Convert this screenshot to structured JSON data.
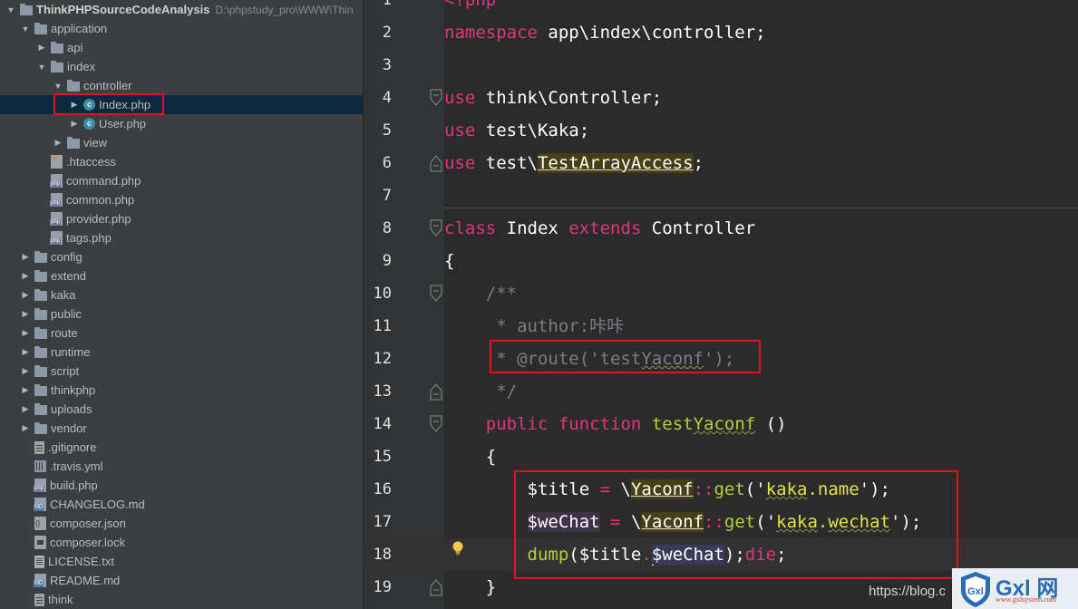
{
  "project_tree": {
    "root_name": "ThinkPHPSourceCodeAnalysis",
    "root_path": "D:\\phpstudy_pro\\WWW\\Thin",
    "items": [
      {
        "label": "application",
        "type": "folder",
        "depth": 1,
        "arrow": "down"
      },
      {
        "label": "api",
        "type": "folder",
        "depth": 2,
        "arrow": "right"
      },
      {
        "label": "index",
        "type": "folder",
        "depth": 2,
        "arrow": "down"
      },
      {
        "label": "controller",
        "type": "folder",
        "depth": 3,
        "arrow": "down"
      },
      {
        "label": "Index.php",
        "type": "class",
        "depth": 4,
        "arrow": "right",
        "selected": true
      },
      {
        "label": "User.php",
        "type": "class",
        "depth": 4,
        "arrow": "right"
      },
      {
        "label": "view",
        "type": "folder",
        "depth": 3,
        "arrow": "right"
      },
      {
        "label": ".htaccess",
        "type": "htaccess",
        "depth": 2,
        "arrow": ""
      },
      {
        "label": "command.php",
        "type": "php",
        "depth": 2,
        "arrow": ""
      },
      {
        "label": "common.php",
        "type": "php",
        "depth": 2,
        "arrow": ""
      },
      {
        "label": "provider.php",
        "type": "php",
        "depth": 2,
        "arrow": ""
      },
      {
        "label": "tags.php",
        "type": "php",
        "depth": 2,
        "arrow": ""
      },
      {
        "label": "config",
        "type": "folder",
        "depth": 1,
        "arrow": "right"
      },
      {
        "label": "extend",
        "type": "folder",
        "depth": 1,
        "arrow": "right"
      },
      {
        "label": "kaka",
        "type": "folder",
        "depth": 1,
        "arrow": "right"
      },
      {
        "label": "public",
        "type": "folder",
        "depth": 1,
        "arrow": "right"
      },
      {
        "label": "route",
        "type": "folder",
        "depth": 1,
        "arrow": "right"
      },
      {
        "label": "runtime",
        "type": "folder",
        "depth": 1,
        "arrow": "right"
      },
      {
        "label": "script",
        "type": "folder",
        "depth": 1,
        "arrow": "right"
      },
      {
        "label": "thinkphp",
        "type": "folder",
        "depth": 1,
        "arrow": "right"
      },
      {
        "label": "uploads",
        "type": "folder",
        "depth": 1,
        "arrow": "right"
      },
      {
        "label": "vendor",
        "type": "folder",
        "depth": 1,
        "arrow": "right"
      },
      {
        "label": ".gitignore",
        "type": "file",
        "depth": 1,
        "arrow": ""
      },
      {
        "label": ".travis.yml",
        "type": "yml",
        "depth": 1,
        "arrow": ""
      },
      {
        "label": "build.php",
        "type": "php",
        "depth": 1,
        "arrow": ""
      },
      {
        "label": "CHANGELOG.md",
        "type": "md",
        "depth": 1,
        "arrow": ""
      },
      {
        "label": "composer.json",
        "type": "json",
        "depth": 1,
        "arrow": ""
      },
      {
        "label": "composer.lock",
        "type": "lock",
        "depth": 1,
        "arrow": ""
      },
      {
        "label": "LICENSE.txt",
        "type": "text",
        "depth": 1,
        "arrow": ""
      },
      {
        "label": "README.md",
        "type": "md",
        "depth": 1,
        "arrow": ""
      },
      {
        "label": "think",
        "type": "file",
        "depth": 1,
        "arrow": ""
      }
    ]
  },
  "editor": {
    "current_line": "18",
    "lines": [
      {
        "num": "1",
        "tokens": [
          {
            "t": "<?php",
            "c": "kw"
          }
        ]
      },
      {
        "num": "2",
        "tokens": [
          {
            "t": "namespace",
            "c": "kw"
          },
          {
            "t": " app\\index\\controller;",
            "c": ""
          }
        ]
      },
      {
        "num": "3",
        "tokens": []
      },
      {
        "num": "4",
        "tokens": [
          {
            "t": "use",
            "c": "kw"
          },
          {
            "t": " think\\Controller;",
            "c": ""
          }
        ]
      },
      {
        "num": "5",
        "tokens": [
          {
            "t": "use",
            "c": "kw"
          },
          {
            "t": " test\\Kaka;",
            "c": ""
          }
        ]
      },
      {
        "num": "6",
        "tokens": [
          {
            "t": "use",
            "c": "kw"
          },
          {
            "t": " test\\",
            "c": ""
          },
          {
            "t": "TestArrayAccess",
            "c": "hl ul"
          },
          {
            "t": ";",
            "c": ""
          }
        ]
      },
      {
        "num": "7",
        "tokens": []
      },
      {
        "num": "8",
        "tokens": [
          {
            "t": "class",
            "c": "kw"
          },
          {
            "t": " Index ",
            "c": ""
          },
          {
            "t": "extends",
            "c": "kw"
          },
          {
            "t": " Controller",
            "c": ""
          }
        ]
      },
      {
        "num": "9",
        "tokens": [
          {
            "t": "{",
            "c": ""
          }
        ]
      },
      {
        "num": "10",
        "tokens": [
          {
            "t": "    /**",
            "c": "cm"
          }
        ]
      },
      {
        "num": "11",
        "tokens": [
          {
            "t": "     * author:咔咔",
            "c": "cm"
          }
        ]
      },
      {
        "num": "12",
        "tokens": [
          {
            "t": "     * @route('test",
            "c": "cm"
          },
          {
            "t": "Yaconf",
            "c": "cm squig"
          },
          {
            "t": "');",
            "c": "cm"
          }
        ]
      },
      {
        "num": "13",
        "tokens": [
          {
            "t": "     */",
            "c": "cm"
          }
        ]
      },
      {
        "num": "14",
        "tokens": [
          {
            "t": "    ",
            "c": ""
          },
          {
            "t": "public",
            "c": "kw"
          },
          {
            "t": " ",
            "c": ""
          },
          {
            "t": "function",
            "c": "kw"
          },
          {
            "t": " test",
            "c": "fn"
          },
          {
            "t": "Yaconf",
            "c": "fn squig"
          },
          {
            "t": " ()",
            "c": ""
          }
        ]
      },
      {
        "num": "15",
        "tokens": [
          {
            "t": "    {",
            "c": ""
          }
        ]
      },
      {
        "num": "16",
        "tokens": [
          {
            "t": "        $title ",
            "c": "var"
          },
          {
            "t": "=",
            "c": "op"
          },
          {
            "t": " \\",
            "c": ""
          },
          {
            "t": "Yaconf",
            "c": "hl ul"
          },
          {
            "t": "::",
            "c": "op"
          },
          {
            "t": "get",
            "c": "fn"
          },
          {
            "t": "('",
            "c": ""
          },
          {
            "t": "kaka",
            "c": "str squig"
          },
          {
            "t": ".name",
            "c": "str"
          },
          {
            "t": "');",
            "c": ""
          }
        ]
      },
      {
        "num": "17",
        "tokens": [
          {
            "t": "        ",
            "c": ""
          },
          {
            "t": "$weChat",
            "c": "var hlv"
          },
          {
            "t": " ",
            "c": ""
          },
          {
            "t": "=",
            "c": "op"
          },
          {
            "t": " \\",
            "c": ""
          },
          {
            "t": "Yaconf",
            "c": "hl ul"
          },
          {
            "t": "::",
            "c": "op"
          },
          {
            "t": "get",
            "c": "fn"
          },
          {
            "t": "('",
            "c": ""
          },
          {
            "t": "kaka",
            "c": "str squig"
          },
          {
            "t": ".",
            "c": "str"
          },
          {
            "t": "wechat",
            "c": "str squig"
          },
          {
            "t": "');",
            "c": ""
          }
        ]
      },
      {
        "num": "18",
        "tokens": [
          {
            "t": "        ",
            "c": ""
          },
          {
            "t": "dump",
            "c": "fn"
          },
          {
            "t": "($title",
            "c": ""
          },
          {
            "t": ".",
            "c": "op"
          },
          {
            "t": "CARET",
            "c": "caret"
          },
          {
            "t": "$weChat",
            "c": "var hlvar"
          },
          {
            "t": ");",
            "c": ""
          },
          {
            "t": "die",
            "c": "kw"
          },
          {
            "t": ";",
            "c": ""
          }
        ]
      },
      {
        "num": "19",
        "tokens": [
          {
            "t": "    }",
            "c": ""
          }
        ]
      }
    ]
  },
  "watermark": {
    "url": "https://blog.c",
    "logo_text": "Gxl 网",
    "logo_sub": "www.gxlsystem.com"
  },
  "colors": {
    "accent_red": "#e0141e",
    "keyword": "#e2357f",
    "function": "#b2d234",
    "string": "#e6e24c",
    "comment": "#7a7e85"
  }
}
